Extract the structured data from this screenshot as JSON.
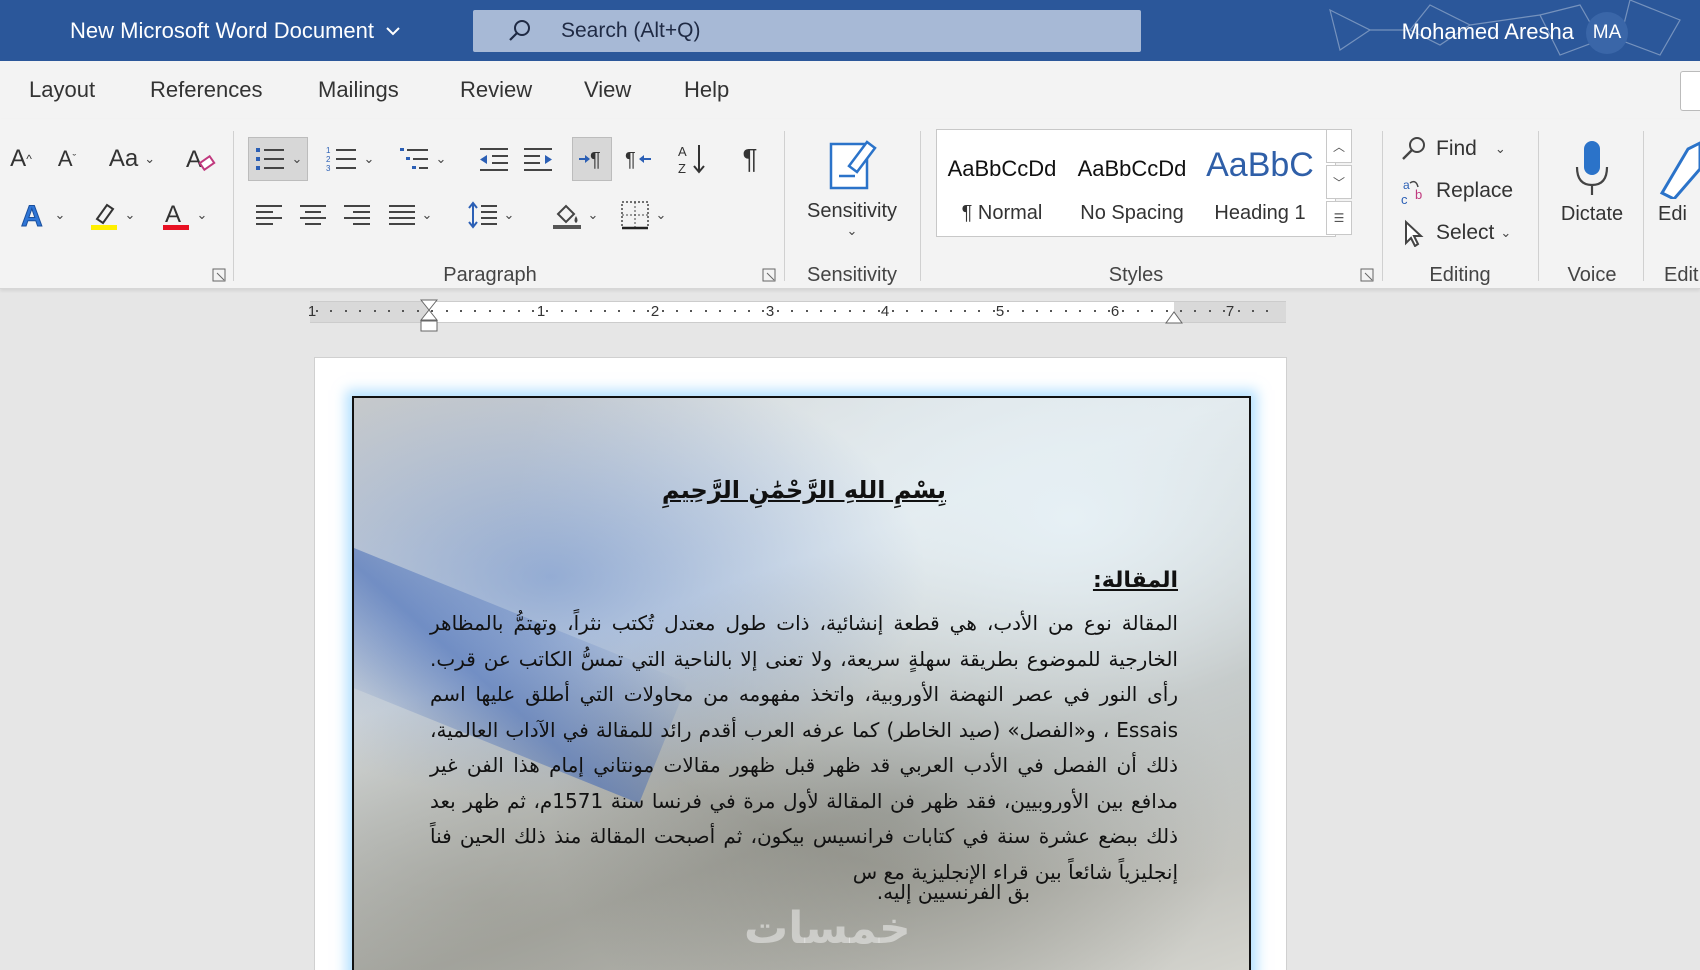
{
  "titlebar": {
    "doc_title": "New Microsoft Word Document",
    "search_placeholder": "Search (Alt+Q)",
    "user_name": "Mohamed Aresha",
    "user_initials": "MA",
    "bg_color": "#2b579a"
  },
  "menu_tabs": [
    "Layout",
    "References",
    "Mailings",
    "Review",
    "View",
    "Help"
  ],
  "ribbon": {
    "groups": {
      "paragraph": "Paragraph",
      "sensitivity": "Sensitivity",
      "styles": "Styles",
      "editing": "Editing",
      "voice": "Voice",
      "editor": "Edit"
    },
    "case_button": "Aa",
    "sensitivity_button": "Sensitivity",
    "styles": [
      {
        "sample": "AaBbCcDd",
        "name": "¶ Normal"
      },
      {
        "sample": "AaBbCcDd",
        "name": "No Spacing"
      },
      {
        "sample": "AaBbC",
        "name": "Heading 1"
      }
    ],
    "editing": {
      "find": "Find",
      "replace": "Replace",
      "select": "Select"
    },
    "dictate": "Dictate",
    "editor_partial": "Edi"
  },
  "ruler": {
    "numbers": [
      "1",
      "1",
      "2",
      "3",
      "4",
      "5",
      "6",
      "7"
    ]
  },
  "document": {
    "basmala": "بِسْمِ اللهِ الرَّحْمَٰنِ الرَّحِيمِ",
    "heading": "المقالة:",
    "paragraph": "المقالة نوع من الأدب، هي قطعة إنشائية، ذات طول معتدل تُكتب نثراً، وتهتمُّ بالمظاهر الخارجية للموضوع بطريقة سهلةٍ سريعة، ولا تعنى إلا بالناحية التي تمسُّ الكاتب عن قرب. رأى النور في عصر النهضة الأوروبية، واتخذ مفهومه من محاولات التي أطلق عليها اسم Essais ، و«الفصل» (صيد الخاطر) كما عرفه العرب أقدم رائد للمقالة في الآداب العالمية، ذلك أن الفصل في الأدب العربي قد ظهر قبل ظهور مقالات مونتاني إمام هذا الفن غير مدافع بين الأوروبيين، فقد ظهر فن المقالة لأول مرة في فرنسا سنة 1571م، ثم ظهر بعد ذلك ببضع عشرة سنة في كتابات فرانسيس بيكون، ثم أصبحت المقالة منذ ذلك الحين فناً إنجليزياً شائعاً بين قراء الإنجليزية مع س",
    "paragraph_end": "بق الفرنسيين إليه.",
    "watermark": "خمسات"
  }
}
